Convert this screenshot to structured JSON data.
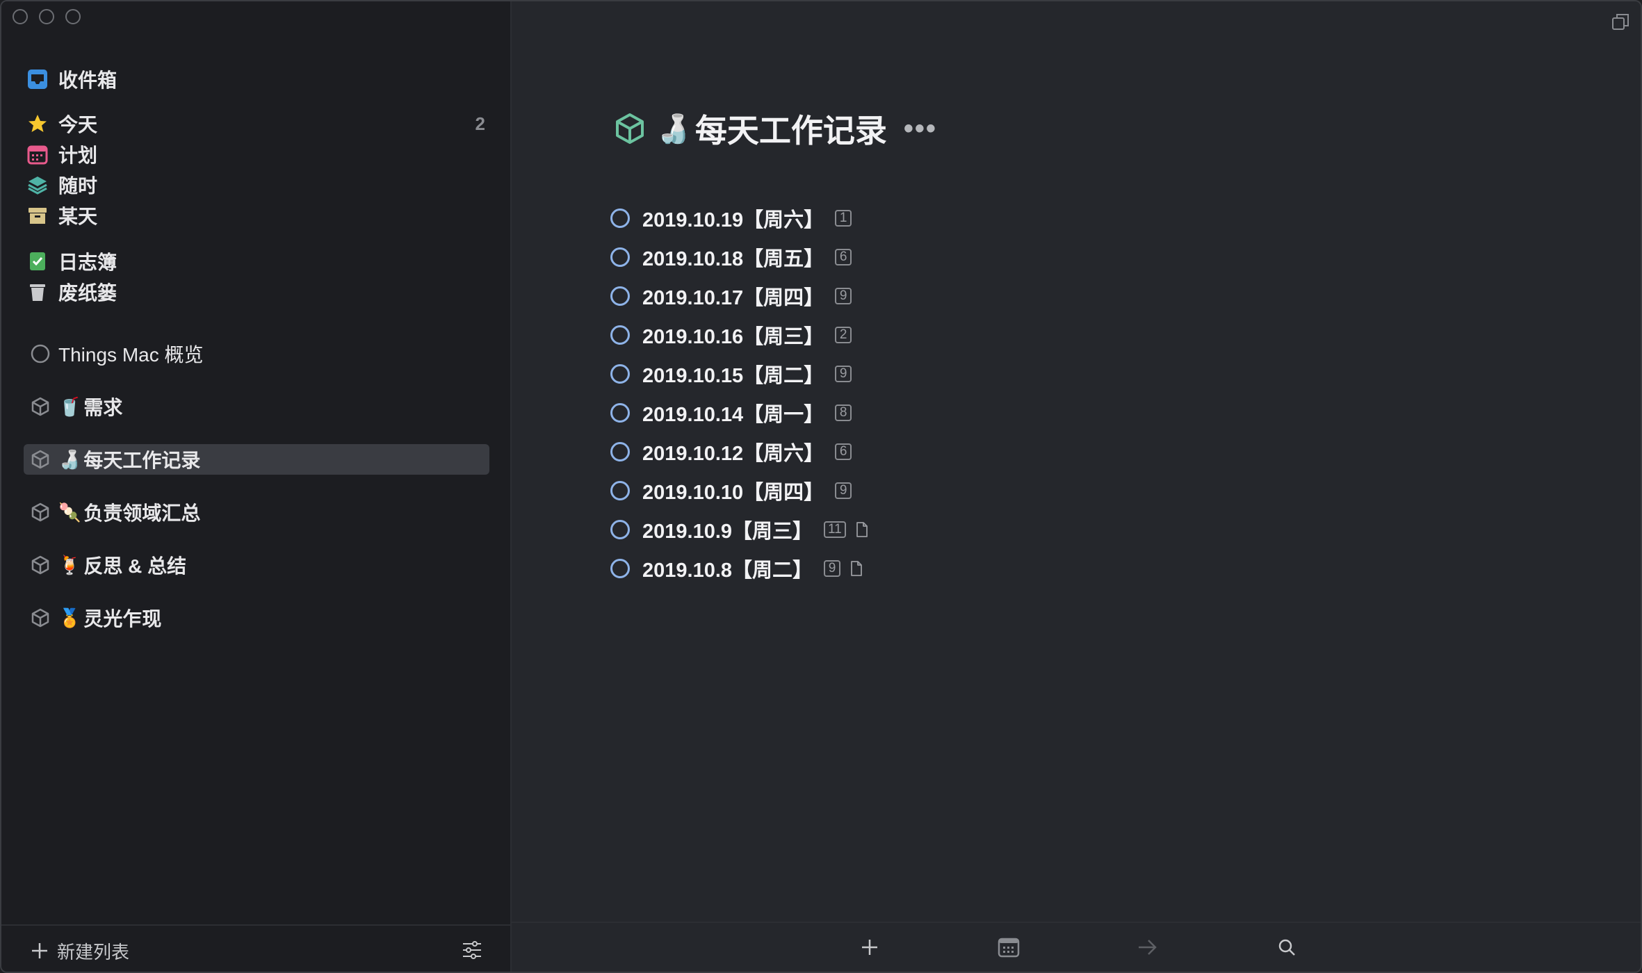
{
  "sidebar": {
    "inbox": {
      "label": "收件箱",
      "icon": "inbox-icon"
    },
    "today": {
      "label": "今天",
      "count": "2",
      "icon": "star-icon"
    },
    "upcoming": {
      "label": "计划",
      "icon": "calendar-icon"
    },
    "anytime": {
      "label": "随时",
      "icon": "layers-icon"
    },
    "someday": {
      "label": "某天",
      "icon": "archive-box-icon"
    },
    "logbook": {
      "label": "日志簿",
      "icon": "logbook-icon"
    },
    "trash": {
      "label": "废纸篓",
      "icon": "trash-icon"
    },
    "projects": [
      {
        "label": "Things Mac 概览",
        "emoji": ""
      },
      {
        "label": "需求",
        "emoji": "🥤"
      },
      {
        "label": "每天工作记录",
        "emoji": "🍶"
      },
      {
        "label": "负责领域汇总",
        "emoji": "🍡"
      },
      {
        "label": "反思 & 总结",
        "emoji": "🍹"
      },
      {
        "label": "灵光乍现",
        "emoji": "🏅"
      }
    ],
    "footer": {
      "new_list_label": "新建列表"
    }
  },
  "main": {
    "title": "每天工作记录",
    "title_emoji": "🍶",
    "more_label": "•••",
    "tasks": [
      {
        "label": "2019.10.19【周六】",
        "count": "1",
        "has_note": false
      },
      {
        "label": "2019.10.18【周五】",
        "count": "6",
        "has_note": false
      },
      {
        "label": "2019.10.17【周四】",
        "count": "9",
        "has_note": false
      },
      {
        "label": "2019.10.16【周三】",
        "count": "2",
        "has_note": false
      },
      {
        "label": "2019.10.15【周二】",
        "count": "9",
        "has_note": false
      },
      {
        "label": "2019.10.14【周一】",
        "count": "8",
        "has_note": false
      },
      {
        "label": "2019.10.12【周六】",
        "count": "6",
        "has_note": false
      },
      {
        "label": "2019.10.10【周四】",
        "count": "9",
        "has_note": false
      },
      {
        "label": "2019.10.9【周三】",
        "count": "11",
        "has_note": true
      },
      {
        "label": "2019.10.8【周二】",
        "count": "9",
        "has_note": true
      }
    ]
  },
  "toolbar": [
    "plus-icon",
    "calendar-icon",
    "arrow-right-icon",
    "search-icon"
  ],
  "colors": {
    "accent_checkbox": "#8eb3e8",
    "project_icon": "#6cc3a0",
    "sidebar_bg": "#1c1d21",
    "main_bg": "#25272c"
  }
}
